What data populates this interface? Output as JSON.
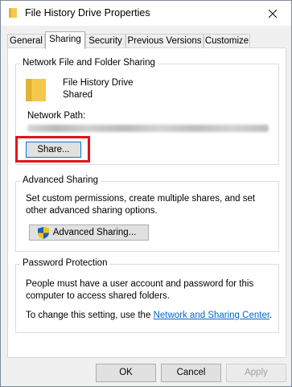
{
  "window": {
    "title": "File History Drive Properties"
  },
  "tabs": [
    {
      "label": "General"
    },
    {
      "label": "Sharing"
    },
    {
      "label": "Security"
    },
    {
      "label": "Previous Versions"
    },
    {
      "label": "Customize"
    }
  ],
  "network_sharing": {
    "group_label": "Network File and Folder Sharing",
    "folder_name": "File History Drive",
    "folder_status": "Shared",
    "network_path_label": "Network Path:",
    "share_button": "Share..."
  },
  "advanced_sharing": {
    "group_label": "Advanced Sharing",
    "description": "Set custom permissions, create multiple shares, and set other advanced sharing options.",
    "button": "Advanced Sharing..."
  },
  "password_protection": {
    "group_label": "Password Protection",
    "description": "People must have a user account and password for this computer to access shared folders.",
    "change_text": "To change this setting, use the",
    "link_text": "Network and Sharing Center",
    "link_suffix": "."
  },
  "buttons": {
    "ok": "OK",
    "cancel": "Cancel",
    "apply": "Apply"
  },
  "colors": {
    "accent": "#0078d7",
    "highlight": "#e0141c",
    "folder": "#f2c94c",
    "link": "#0066cc"
  }
}
